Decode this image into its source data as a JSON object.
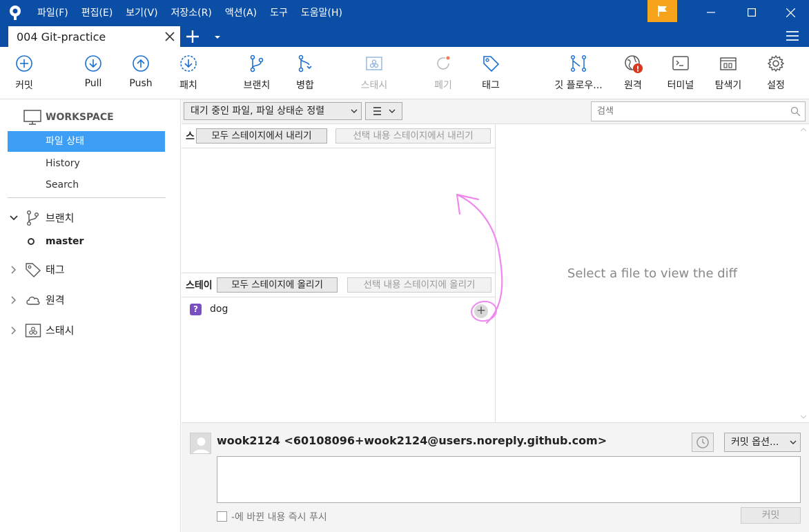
{
  "menu": [
    "파일(F)",
    "편집(E)",
    "보기(V)",
    "저장소(R)",
    "액션(A)",
    "도구",
    "도움말(H)"
  ],
  "tab": {
    "label": "004 Git-practice"
  },
  "toolbar": {
    "commit": "커밋",
    "pull": "Pull",
    "push": "Push",
    "patch": "패치",
    "branch": "브랜치",
    "merge": "병합",
    "stash": "스태시",
    "discard": "폐기",
    "tag": "태그",
    "gitflow": "깃 플로우...",
    "remote": "원격",
    "terminal": "터미널",
    "explorer": "탐색기",
    "settings": "설정"
  },
  "sidebar": {
    "workspace": "WORKSPACE",
    "items": [
      "파일 상태",
      "History",
      "Search"
    ],
    "branches": "브랜치",
    "current_branch": "master",
    "tags": "태그",
    "remotes": "원격",
    "stashes": "스태시"
  },
  "filter": {
    "sort": "대기 중인 파일, 파일 상태순 정렬",
    "search_placeholder": "검색"
  },
  "staged": {
    "label": "스",
    "unstage_all": "모두 스테이지에서 내리기",
    "unstage_selected": "선택 내용 스테이지에서 내리기"
  },
  "unstaged": {
    "label": "스테이",
    "stage_all": "모두 스테이지에 올리기",
    "stage_selected": "선택 내용 스테이지에 올리기",
    "files": [
      {
        "name": "dog",
        "status": "?"
      }
    ]
  },
  "diff": {
    "message": "Select a file to view the diff"
  },
  "commit": {
    "author": "wook2124 <60108096+wook2124@users.noreply.github.com>",
    "options": "커밋 옵션...",
    "push_label": "-에 바뀐 내용 즉시 푸시",
    "button": "커밋"
  },
  "colors": {
    "accent": "#0b4ea6",
    "selection": "#3d9ef5",
    "flag": "#f6a41c",
    "annotation": "#f088f0"
  }
}
